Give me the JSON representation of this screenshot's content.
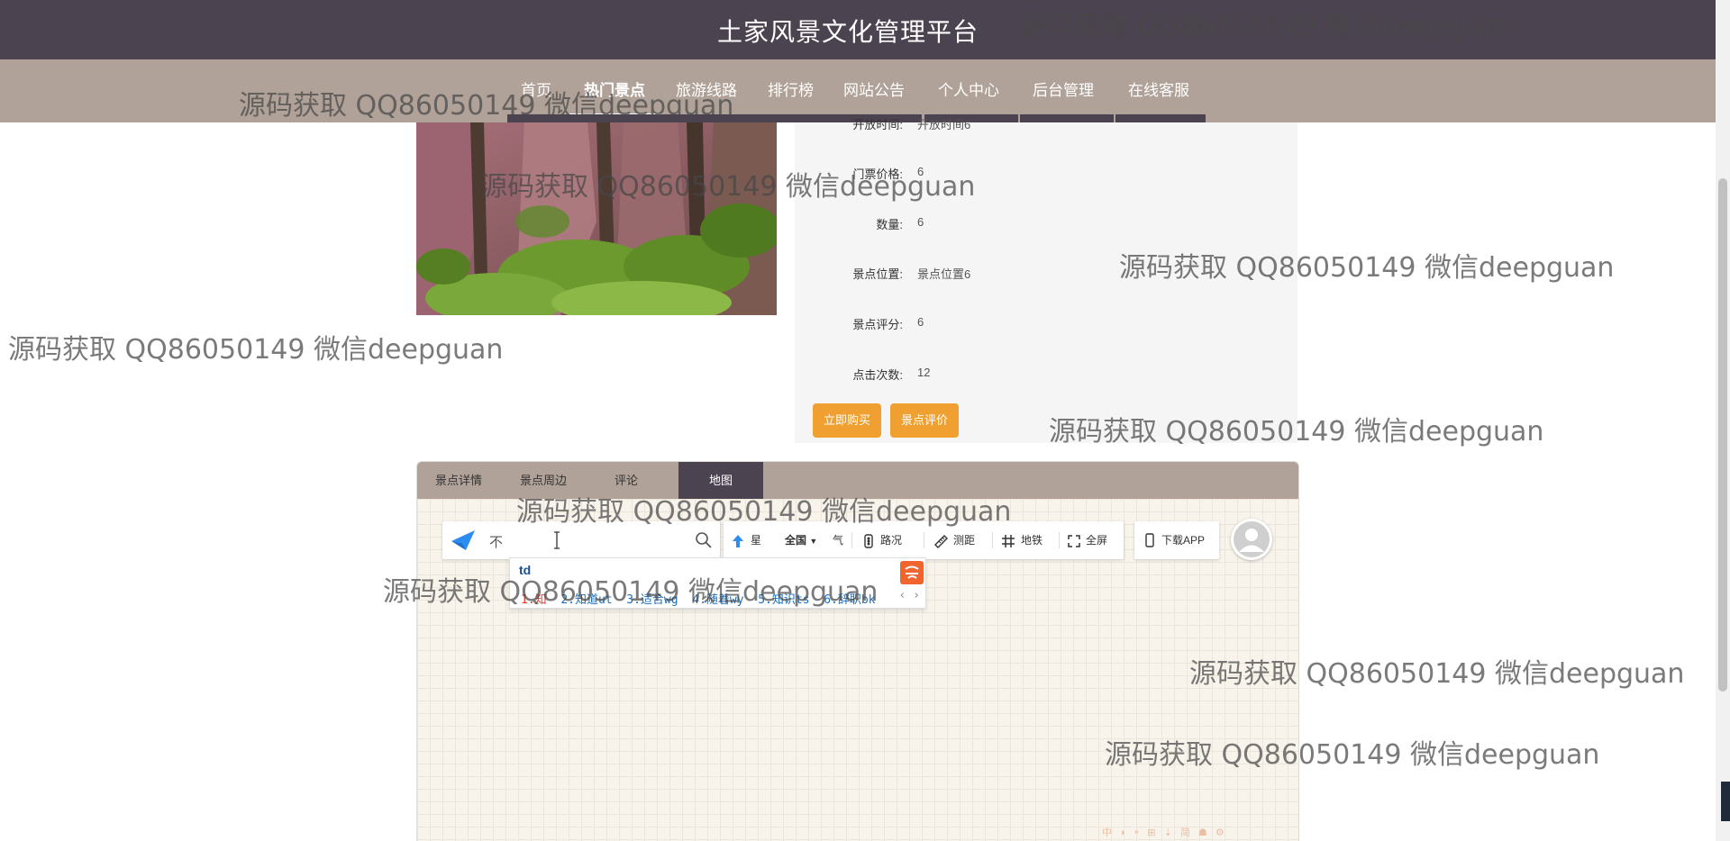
{
  "header": {
    "title": "土家风景文化管理平台"
  },
  "nav": {
    "items": [
      {
        "label": "首页"
      },
      {
        "label": "热门景点"
      },
      {
        "label": "旅游线路"
      },
      {
        "label": "排行榜"
      },
      {
        "label": "网站公告"
      },
      {
        "label": "个人中心"
      },
      {
        "label": "后台管理"
      },
      {
        "label": "在线客服"
      }
    ],
    "active_index": 1
  },
  "spot": {
    "fields": [
      {
        "label": "开放时间:",
        "value": "开放时间6"
      },
      {
        "label": "门票价格:",
        "value": "6"
      },
      {
        "label": "数量:",
        "value": "6"
      },
      {
        "label": "景点位置:",
        "value": "景点位置6"
      },
      {
        "label": "景点评分:",
        "value": "6"
      },
      {
        "label": "点击次数:",
        "value": "12"
      }
    ],
    "buttons": {
      "buy": "立即购买",
      "review": "景点评价"
    }
  },
  "tabs": {
    "items": [
      {
        "label": "景点详情"
      },
      {
        "label": "景点周边"
      },
      {
        "label": "评论"
      },
      {
        "label": "地图"
      }
    ],
    "active_index": 3
  },
  "map": {
    "search": {
      "query": "不"
    },
    "tools": {
      "star": "星",
      "region": "全国",
      "weather": "气",
      "traffic": "路况",
      "measure": "测距",
      "subway": "地铁",
      "fullscreen": "全屏"
    },
    "download_app": "下载APP",
    "footer_icons": "中 ◗ ⁍ ⊞ ⇣ 简 ☗ ⚙"
  },
  "ime": {
    "composition": "td",
    "candidates": [
      {
        "text": "1.知"
      },
      {
        "text": "2.知道ut"
      },
      {
        "text": "3.适合wg"
      },
      {
        "text": "4.随着wy"
      },
      {
        "text": "5.知识ts"
      },
      {
        "text": "6.辞职bk"
      }
    ],
    "pager": "‹ ›"
  },
  "watermarks": [
    "源码获取 QQ86050149 微信deepguan",
    "源码获取 QQ86050149 微信deepguan",
    "源码获取 QQ86050149 微信deepguan",
    "源码获取 QQ86050149 微信deepguan",
    "源码获取 QQ86050149 微信deepguan",
    "源码获取 QQ86050149 微信deepguan",
    "源码获取 QQ86050149 微信deepguan",
    "源码获取 QQ86050149 微信deepguan",
    "源码获取 QQ86050149 微信deepguan",
    "源码获取 QQ86050149 微信deepguan"
  ],
  "colors": {
    "header_bg": "#4c4350",
    "nav_bg": "#b0a298",
    "accent_orange": "#f0a030",
    "info_panel_bg": "#f5f5f5"
  }
}
